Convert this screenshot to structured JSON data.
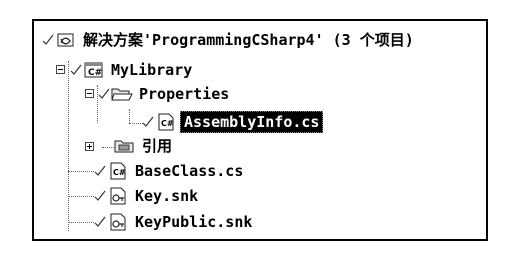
{
  "solution": {
    "label": "解决方案'ProgrammingCSharp4' (3 个项目)",
    "icon": "solution-icon"
  },
  "project": {
    "label": "MyLibrary",
    "icon": "csharp-project-icon",
    "expanded": true
  },
  "items": [
    {
      "label": "Properties",
      "icon": "folder-open-icon",
      "expanded": true
    },
    {
      "label": "AssemblyInfo.cs",
      "icon": "cs-file-icon",
      "selected": true
    },
    {
      "label": "引用",
      "icon": "references-icon",
      "expanded": false
    },
    {
      "label": "BaseClass.cs",
      "icon": "cs-file-icon"
    },
    {
      "label": "Key.snk",
      "icon": "snk-file-icon"
    },
    {
      "label": "KeyPublic.snk",
      "icon": "snk-file-icon"
    }
  ]
}
